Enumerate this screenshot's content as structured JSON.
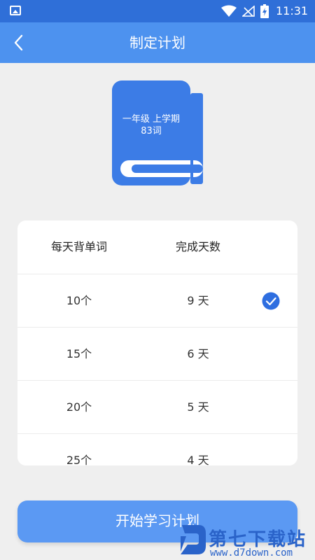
{
  "status_bar": {
    "time": "11:31"
  },
  "header": {
    "title": "制定计划",
    "back_icon": "chevron-left-icon"
  },
  "book": {
    "line1": "一年级 上学期",
    "line2": "83词"
  },
  "table": {
    "col1_header": "每天背单词",
    "col2_header": "完成天数",
    "rows": [
      {
        "words": "10个",
        "days": "9  天",
        "selected": true
      },
      {
        "words": "15个",
        "days": "6  天",
        "selected": false
      },
      {
        "words": "20个",
        "days": "5  天",
        "selected": false
      },
      {
        "words": "25个",
        "days": "4  天",
        "selected": false
      }
    ]
  },
  "start_button": {
    "label": "开始学习计划"
  },
  "watermark": {
    "name": "第七下载站",
    "url": "www.d7down.com"
  },
  "colors": {
    "status_bar": "#2f6fd8",
    "header": "#4d92ef",
    "book": "#3c7ce6",
    "button": "#5b99f3",
    "check": "#2e6ee0"
  }
}
